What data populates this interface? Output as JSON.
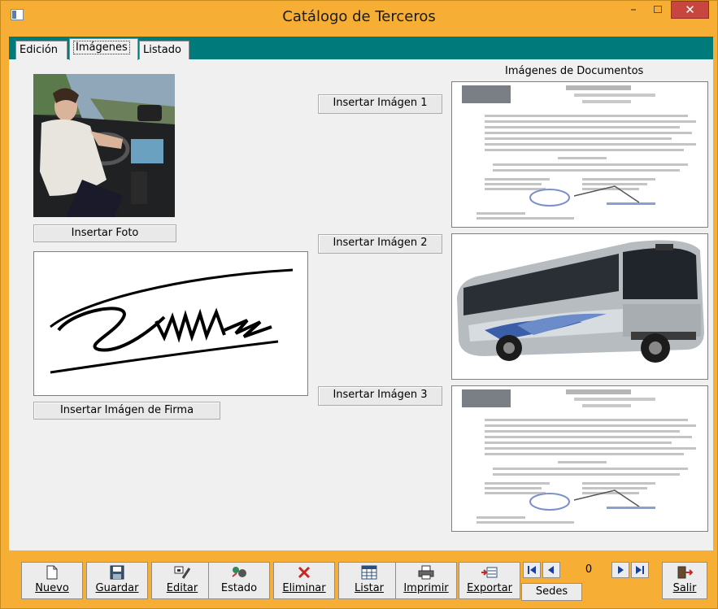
{
  "window": {
    "title": "Catálogo de Terceros",
    "minimize": "–",
    "close": "✕"
  },
  "tabs": [
    {
      "label": "Edición"
    },
    {
      "label": "Imágenes"
    },
    {
      "label": "Listado"
    }
  ],
  "images_tab": {
    "photo_button": "Insertar Foto",
    "signature_button": "Insertar Imágen de Firma",
    "documents_title": "Imágenes de Documentos",
    "doc_buttons": [
      "Insertar Imágen 1",
      "Insertar Imágen 2",
      "Insertar Imágen 3"
    ]
  },
  "toolbar": {
    "items": [
      {
        "label": "Nuevo",
        "icon": "new-document-icon"
      },
      {
        "label": "Guardar",
        "icon": "save-icon"
      },
      {
        "label": "Editar",
        "icon": "edit-icon"
      },
      {
        "label": "Estado",
        "icon": "status-icon"
      },
      {
        "label": "Eliminar",
        "icon": "delete-icon"
      },
      {
        "label": "Listar",
        "icon": "list-icon"
      },
      {
        "label": "Imprimir",
        "icon": "print-icon"
      },
      {
        "label": "Exportar",
        "icon": "export-icon"
      }
    ],
    "record_counter": "0",
    "sedes_label": "Sedes",
    "exit_label": "Salir"
  },
  "colors": {
    "window_frame": "#f6ae34",
    "tab_band": "#007a7a",
    "panel": "#f0f0f0",
    "close_button": "#c7463f"
  }
}
